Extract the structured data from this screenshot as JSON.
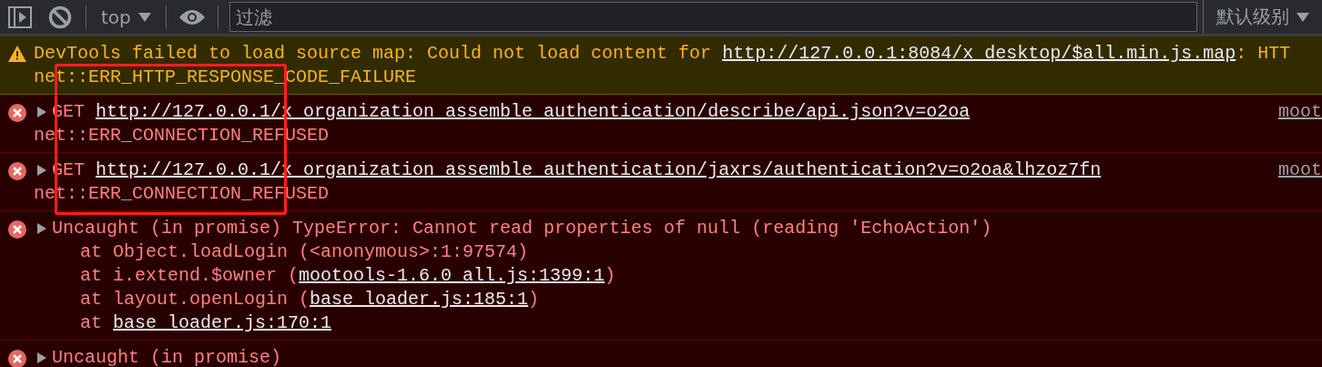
{
  "toolbar": {
    "context": "top",
    "filter": {
      "placeholder": "过滤"
    },
    "levels": "默认级别"
  },
  "messages": [
    {
      "kind": "warning",
      "expandable": false,
      "text": "DevTools failed to load source map: Could not load content for ",
      "link": "http://127.0.0.1:8084/x_desktop/$all.min.js.map",
      "suffix": ": HTT",
      "continuation": "net::ERR_HTTP_RESPONSE_CODE_FAILURE"
    },
    {
      "kind": "error",
      "expandable": true,
      "text": "GET ",
      "link": "http://127.0.0.1/x_organization_assemble_authentication/describe/api.json?v=o2oa",
      "continuation": "net::ERR_CONNECTION_REFUSED",
      "source": "moot"
    },
    {
      "kind": "error",
      "expandable": true,
      "text": "GET ",
      "link": "http://127.0.0.1/x_organization_assemble_authentication/jaxrs/authentication?v=o2oa&lhzoz7fn",
      "continuation": "net::ERR_CONNECTION_REFUSED",
      "source": "moot"
    },
    {
      "kind": "error",
      "expandable": true,
      "text": "Uncaught (in promise) TypeError: Cannot read properties of null (reading 'EchoAction')",
      "frames": [
        {
          "prefix": "at Object.loadLogin (<anonymous>:1:97574)"
        },
        {
          "prefix": "at i.extend.$owner (",
          "link": "mootools-1.6.0_all.js:1399:1",
          "suffix": ")"
        },
        {
          "prefix": "at layout.openLogin (",
          "link": "base_loader.js:185:1",
          "suffix": ")"
        },
        {
          "prefix": "at ",
          "link": "base_loader.js:170:1"
        }
      ]
    },
    {
      "kind": "error",
      "expandable": true,
      "text": "Uncaught (in promise)"
    }
  ],
  "highlight_box": {
    "shown": true
  }
}
